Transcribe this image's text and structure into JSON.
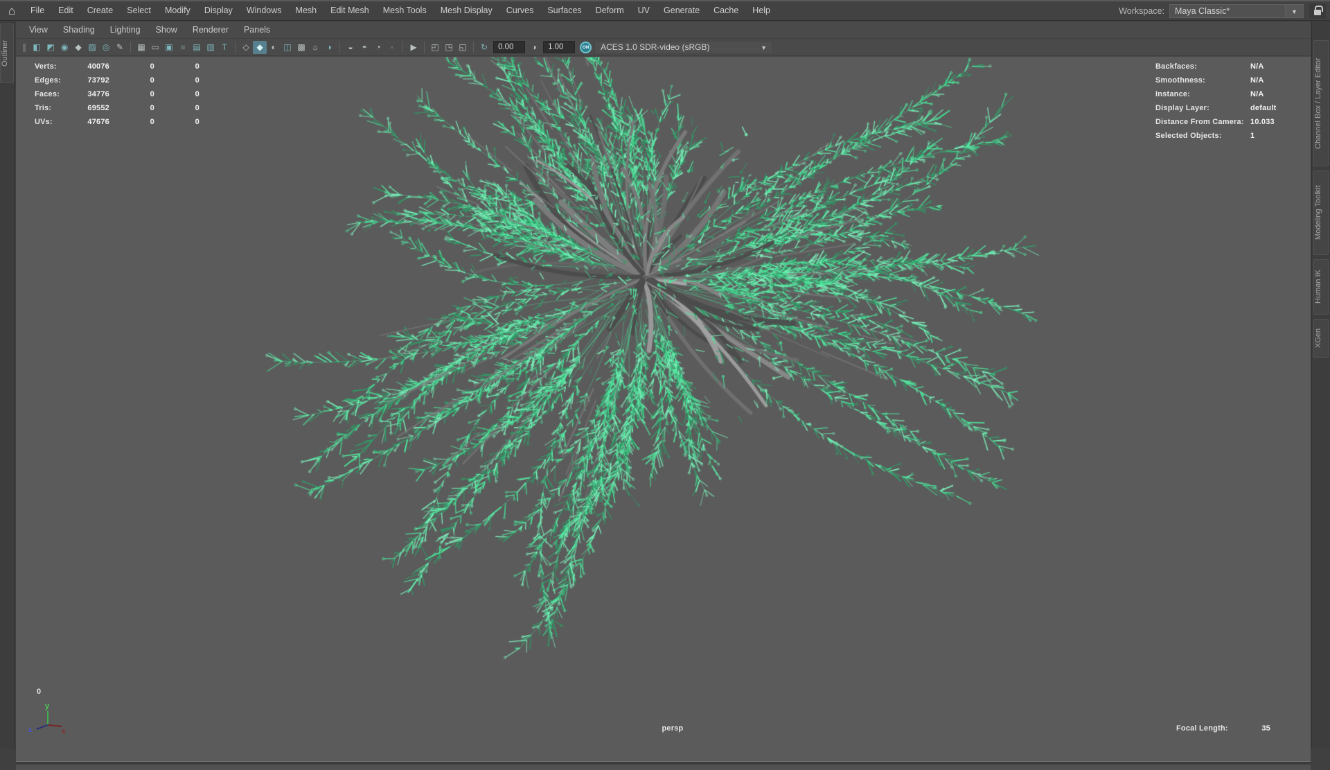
{
  "app": {
    "menus": [
      "File",
      "Edit",
      "Create",
      "Select",
      "Modify",
      "Display",
      "Windows",
      "Mesh",
      "Edit Mesh",
      "Mesh Tools",
      "Mesh Display",
      "Curves",
      "Surfaces",
      "Deform",
      "UV",
      "Generate",
      "Cache",
      "Help"
    ],
    "workspace_label": "Workspace:",
    "workspace_value": "Maya Classic*",
    "home_glyph": "⌂",
    "dropdown_arrow": "▼"
  },
  "panel_menu": {
    "items": [
      "View",
      "Shading",
      "Lighting",
      "Show",
      "Renderer",
      "Panels"
    ]
  },
  "toolbar": {
    "icons": [
      {
        "name": "select-camera",
        "glyph": "◧"
      },
      {
        "name": "lock-camera",
        "glyph": "◩"
      },
      {
        "name": "camera-attributes",
        "glyph": "◉"
      },
      {
        "name": "bookmarks",
        "glyph": "◆"
      },
      {
        "name": "image-plane",
        "glyph": "▨"
      },
      {
        "name": "2d-pan-zoom",
        "glyph": "◎"
      },
      {
        "name": "grease-pencil",
        "glyph": "✎"
      },
      {
        "name": "grid",
        "glyph": "▦"
      },
      {
        "name": "film-gate",
        "glyph": "▭"
      },
      {
        "name": "resolution-gate",
        "glyph": "▣"
      },
      {
        "name": "gate-mask",
        "glyph": "■"
      },
      {
        "name": "field-chart",
        "glyph": "▤"
      },
      {
        "name": "safe-action",
        "glyph": "▥"
      },
      {
        "name": "safe-title",
        "glyph": "T"
      },
      {
        "name": "wireframe-display",
        "glyph": "◇"
      },
      {
        "name": "shaded-display",
        "glyph": "◆"
      },
      {
        "name": "textured-display",
        "glyph": "◐"
      },
      {
        "name": "default-material",
        "glyph": "◫"
      },
      {
        "name": "checker-display",
        "glyph": "▩"
      },
      {
        "name": "use-all-lights",
        "glyph": "☼"
      },
      {
        "name": "shadows",
        "glyph": "◑"
      },
      {
        "name": "screen-space-ao",
        "glyph": "◒"
      },
      {
        "name": "motion-blur",
        "glyph": "◓"
      },
      {
        "name": "depth-of-field",
        "glyph": "◔"
      },
      {
        "name": "fog",
        "glyph": "▪"
      },
      {
        "name": "select-tool",
        "glyph": "▶"
      },
      {
        "name": "isolate-select",
        "glyph": "◰"
      },
      {
        "name": "xray-display",
        "glyph": "◳"
      },
      {
        "name": "xray-joints",
        "glyph": "◱"
      },
      {
        "name": "exposure",
        "glyph": "↻"
      },
      {
        "name": "gamma",
        "glyph": "◑"
      }
    ],
    "exposure_value": "0.00",
    "gamma_value": "1.00",
    "on_toggle": "ON",
    "colorspace": "ACES 1.0 SDR-video (sRGB)"
  },
  "hud": {
    "left": [
      {
        "label": "Verts:",
        "v1": "40076",
        "v2": "0",
        "v3": "0"
      },
      {
        "label": "Edges:",
        "v1": "73792",
        "v2": "0",
        "v3": "0"
      },
      {
        "label": "Faces:",
        "v1": "34776",
        "v2": "0",
        "v3": "0"
      },
      {
        "label": "Tris:",
        "v1": "69552",
        "v2": "0",
        "v3": "0"
      },
      {
        "label": "UVs:",
        "v1": "47676",
        "v2": "0",
        "v3": "0"
      }
    ],
    "right": [
      {
        "label": "Backfaces:",
        "value": "N/A"
      },
      {
        "label": "Smoothness:",
        "value": "N/A"
      },
      {
        "label": "Instance:",
        "value": "N/A"
      },
      {
        "label": "Display Layer:",
        "value": "default"
      },
      {
        "label": "Distance From Camera:",
        "value": "10.033"
      },
      {
        "label": "Selected Objects:",
        "value": "1"
      }
    ],
    "frame": "0",
    "camera": "persp",
    "focal_label": "Focal Length:",
    "focal_value": "35"
  },
  "sidebars": {
    "left_tabs": [
      "Outliner"
    ],
    "right_tabs": [
      "Channel Box / Layer Editor",
      "Modeling Toolkit",
      "Human IK",
      "XGen"
    ]
  },
  "gizmo": {
    "x": "x",
    "y": "y",
    "z": "z"
  },
  "viewport": {
    "colors": {
      "background": "#5b5b5b",
      "wire_green": "#4ee79d",
      "wire_green_bright": "#7df2bc",
      "wire_green_dark": "#2f9e68",
      "branch_gray": "#989898",
      "branch_gray_mid": "#777777",
      "branch_gray_dark": "#4c4c4c"
    }
  }
}
